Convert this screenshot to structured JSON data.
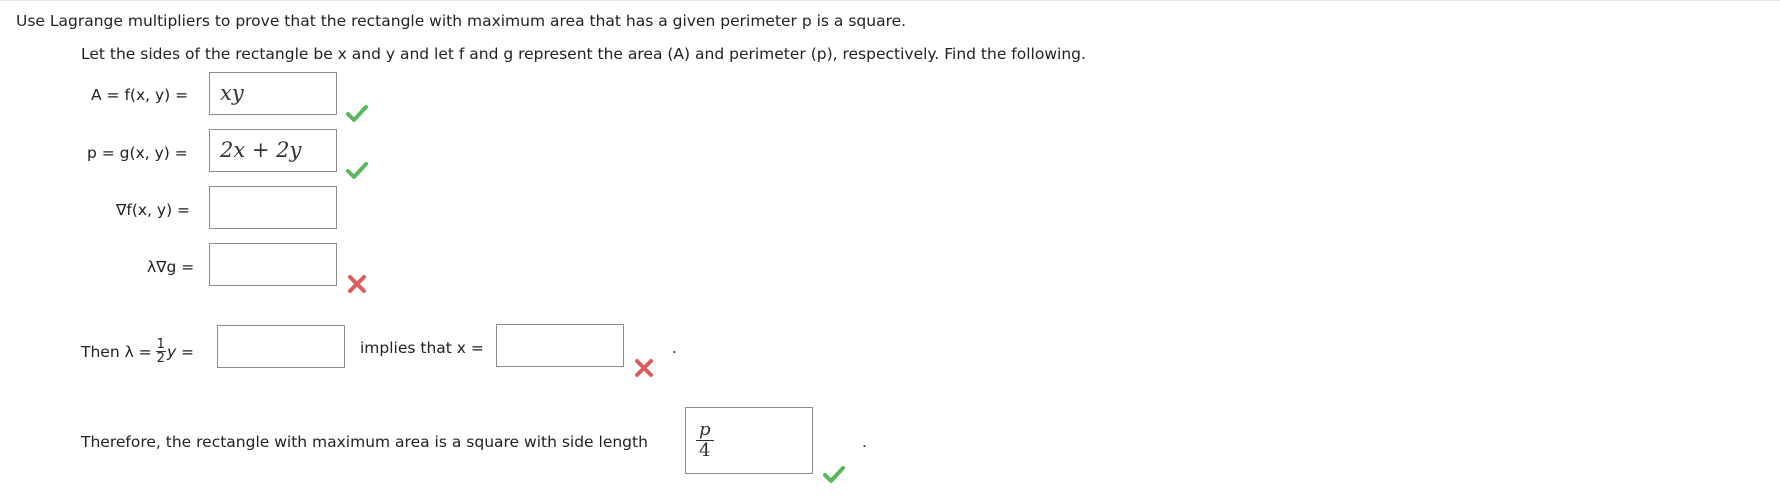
{
  "question": {
    "prompt": "Use Lagrange multipliers to prove that the rectangle with maximum area that has a given perimeter p is a square.",
    "instruction": "Let the sides of the rectangle be x and y and let f and g represent the area (A) and perimeter (p), respectively. Find the following."
  },
  "rows": [
    {
      "label": "A = f(x, y)  =",
      "answer": "xy",
      "status": "correct"
    },
    {
      "label": "p = g(x, y)  =",
      "answer": "2x + 2y",
      "status": "correct"
    },
    {
      "label": "∇f(x, y)  =",
      "answer": "",
      "status": "none"
    },
    {
      "label": "λ∇g  =",
      "answer": "",
      "status": "incorrect"
    }
  ],
  "then_row": {
    "prefix": "Then  λ =",
    "fraction_num": "1",
    "fraction_den": "2",
    "var": "y =",
    "middle": "implies that x =",
    "lambda_answer": "",
    "x_answer": "",
    "status": "incorrect",
    "end": "."
  },
  "conclusion": {
    "text": "Therefore, the rectangle with maximum area is a square with side length",
    "answer_num": "p",
    "answer_den": "4",
    "status": "correct",
    "end": "."
  },
  "colors": {
    "correct": "#5cb85c",
    "incorrect": "#e05a5a"
  }
}
